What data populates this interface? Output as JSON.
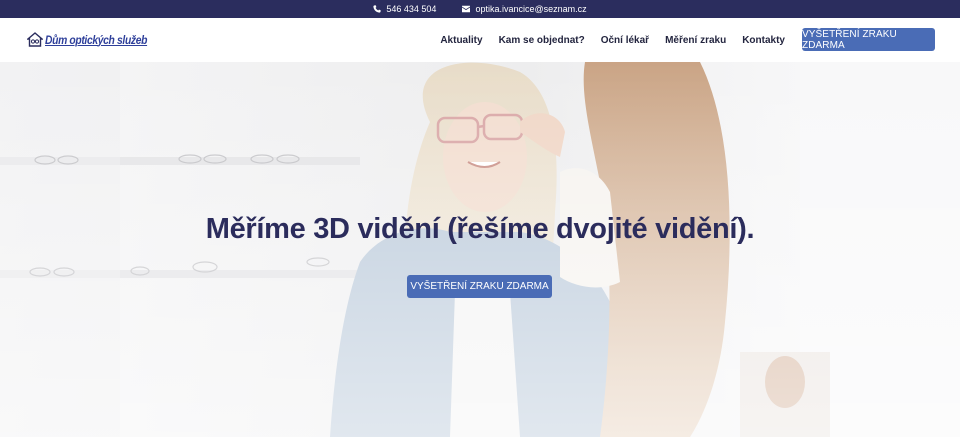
{
  "topbar": {
    "phone": "546 434 504",
    "email": "optika.ivancice@seznam.cz"
  },
  "header": {
    "logo_text": "Dům optických služeb",
    "nav": [
      "Aktuality",
      "Kam se objednat?",
      "Oční lékař",
      "Měření zraku",
      "Kontakty"
    ],
    "cta_label": "VYŠETŘENÍ ZRAKU ZDARMA"
  },
  "hero": {
    "title": "Měříme 3D vidění (řešíme dvojité vidění).",
    "cta_label": "VYŠETŘENÍ ZRAKU ZDARMA"
  },
  "colors": {
    "topbar_bg": "#2b2d5e",
    "accent": "#4a6cb6",
    "title": "#2b2c5c",
    "logo": "#2e3f9a"
  }
}
